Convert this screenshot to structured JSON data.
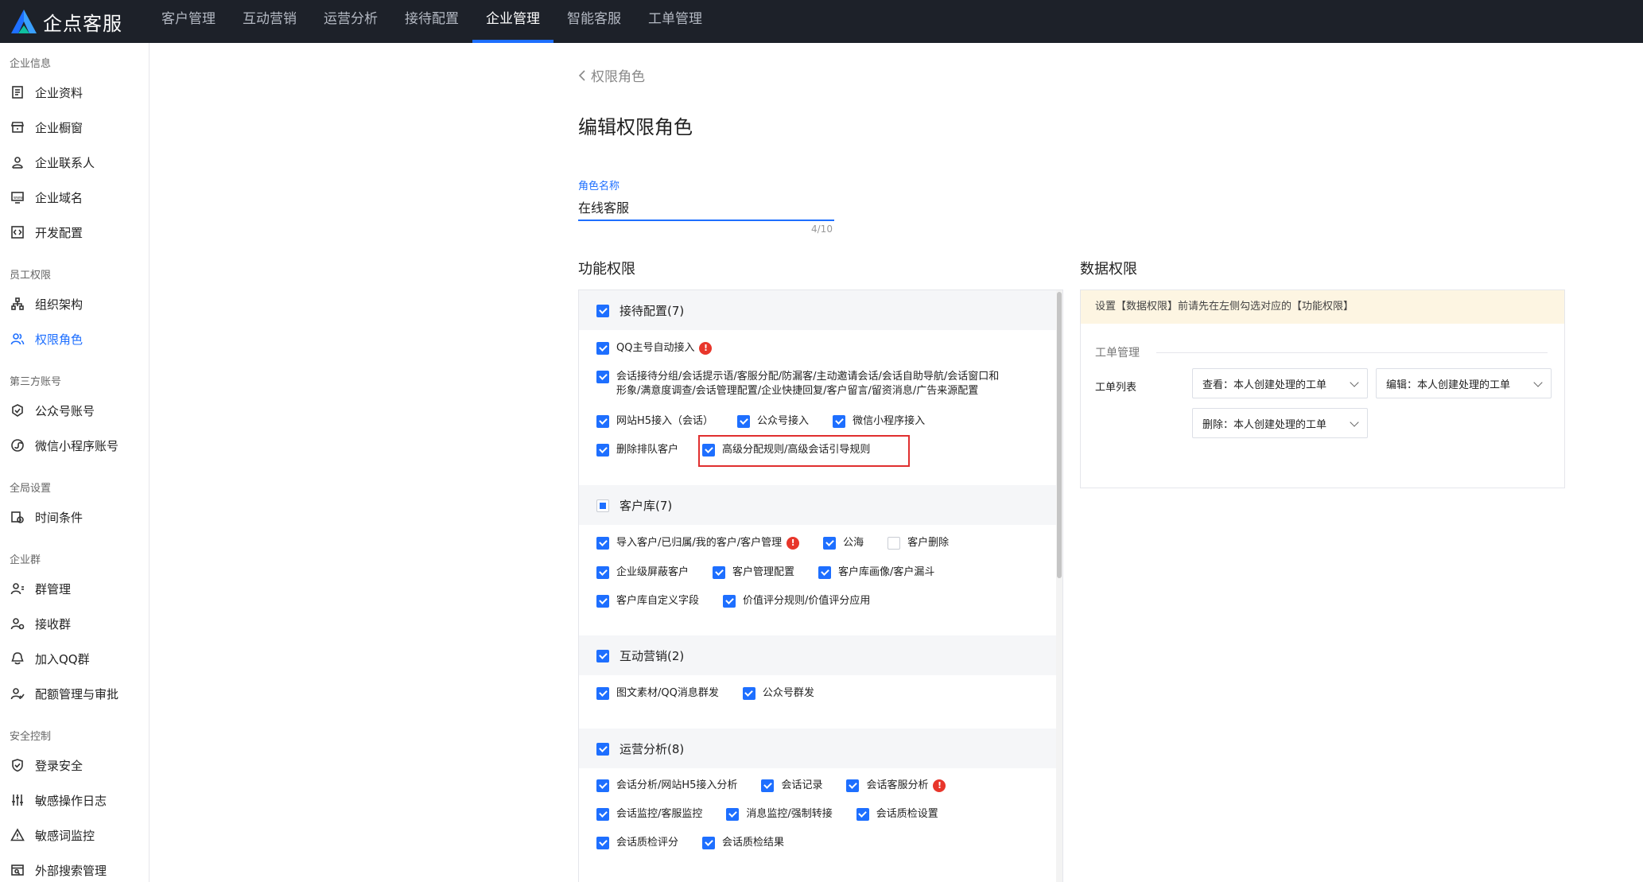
{
  "brand": {
    "name": "企点客服"
  },
  "nav": [
    "客户管理",
    "互动营销",
    "运营分析",
    "接待配置",
    "企业管理",
    "智能客服",
    "工单管理"
  ],
  "nav_active": 4,
  "sidebar": [
    {
      "group": "企业信息",
      "items": [
        {
          "label": "企业资料",
          "icon": "document-icon"
        },
        {
          "label": "企业橱窗",
          "icon": "storefront-icon"
        },
        {
          "label": "企业联系人",
          "icon": "contact-person-icon"
        },
        {
          "label": "企业域名",
          "icon": "domain-icon"
        },
        {
          "label": "开发配置",
          "icon": "code-icon"
        }
      ]
    },
    {
      "group": "员工权限",
      "items": [
        {
          "label": "组织架构",
          "icon": "org-tree-icon"
        },
        {
          "label": "权限角色",
          "icon": "role-users-icon",
          "active": true
        }
      ]
    },
    {
      "group": "第三方账号",
      "items": [
        {
          "label": "公众号账号",
          "icon": "official-account-icon"
        },
        {
          "label": "微信小程序账号",
          "icon": "mini-program-icon"
        }
      ]
    },
    {
      "group": "全局设置",
      "items": [
        {
          "label": "时间条件",
          "icon": "time-condition-icon"
        }
      ]
    },
    {
      "group": "企业群",
      "items": [
        {
          "label": "群管理",
          "icon": "group-manage-icon"
        },
        {
          "label": "接收群",
          "icon": "receive-group-icon"
        },
        {
          "label": "加入QQ群",
          "icon": "join-qq-group-icon"
        },
        {
          "label": "配额管理与审批",
          "icon": "quota-approval-icon"
        }
      ]
    },
    {
      "group": "安全控制",
      "items": [
        {
          "label": "登录安全",
          "icon": "shield-icon"
        },
        {
          "label": "敏感操作日志",
          "icon": "sliders-icon"
        },
        {
          "label": "敏感词监控",
          "icon": "warning-triangle-icon"
        },
        {
          "label": "外部搜索管理",
          "icon": "search-manage-icon"
        }
      ]
    }
  ],
  "main": {
    "back_label": "权限角色",
    "title": "编辑权限角色",
    "role_name_label": "角色名称",
    "role_name_value": "在线客服",
    "role_name_count": "4/10",
    "func_title": "功能权限",
    "data_title": "数据权限"
  },
  "func_groups": [
    {
      "title": "接待配置(7)",
      "state": "on",
      "rows": [
        [
          {
            "label": "QQ主号自动接入",
            "state": "on",
            "warn": true
          }
        ],
        [
          {
            "label": "会话接待分组/会话提示语/客服分配/防漏客/主动邀请会话/会话自助导航/会话窗口和形象/满意度调查/会话管理配置/企业快捷回复/客户留言/留资消息/广告来源配置",
            "state": "on"
          }
        ],
        [
          {
            "label": "网站H5接入（会话）",
            "state": "on"
          },
          {
            "label": "公众号接入",
            "state": "on"
          },
          {
            "label": "微信小程序接入",
            "state": "on"
          }
        ],
        [
          {
            "label": "删除排队客户",
            "state": "on"
          },
          {
            "label": "高级分配规则/高级会话引导规则",
            "state": "on"
          }
        ]
      ]
    },
    {
      "title": "客户库(7)",
      "state": "half",
      "rows": [
        [
          {
            "label": "导入客户/已归属/我的客户/客户管理",
            "state": "on",
            "warn": true
          },
          {
            "label": "公海",
            "state": "on"
          },
          {
            "label": "客户删除",
            "state": "off"
          }
        ],
        [
          {
            "label": "企业级屏蔽客户",
            "state": "on"
          },
          {
            "label": "客户管理配置",
            "state": "on"
          },
          {
            "label": "客户库画像/客户漏斗",
            "state": "on"
          }
        ],
        [
          {
            "label": "客户库自定义字段",
            "state": "on"
          },
          {
            "label": "价值评分规则/价值评分应用",
            "state": "on"
          }
        ]
      ]
    },
    {
      "title": "互动营销(2)",
      "state": "on",
      "rows": [
        [
          {
            "label": "图文素材/QQ消息群发",
            "state": "on"
          },
          {
            "label": "公众号群发",
            "state": "on"
          }
        ]
      ]
    },
    {
      "title": "运营分析(8)",
      "state": "on",
      "rows": [
        [
          {
            "label": "会话分析/网站H5接入分析",
            "state": "on"
          },
          {
            "label": "会话记录",
            "state": "on"
          },
          {
            "label": "会话客服分析",
            "state": "on",
            "warn": true
          }
        ],
        [
          {
            "label": "会话监控/客服监控",
            "state": "on"
          },
          {
            "label": "消息监控/强制转接",
            "state": "on"
          },
          {
            "label": "会话质检设置",
            "state": "on"
          }
        ],
        [
          {
            "label": "会话质检评分",
            "state": "on"
          },
          {
            "label": "会话质检结果",
            "state": "on"
          }
        ]
      ]
    }
  ],
  "data_perm": {
    "notice": "设置【数据权限】前请先在左侧勾选对应的【功能权限】",
    "module_title": "工单管理",
    "row_label": "工单列表",
    "selects": [
      {
        "label": "查看：",
        "value": "本人创建处理的工单"
      },
      {
        "label": "编辑：",
        "value": "本人创建处理的工单"
      },
      {
        "label": "删除：",
        "value": "本人创建处理的工单"
      }
    ]
  },
  "colors": {
    "accent": "#1e6fff",
    "topbar": "#1d2129",
    "warn": "#e8362b",
    "notice_bg": "#fdf5e2",
    "highlight": "#e02f2f"
  }
}
